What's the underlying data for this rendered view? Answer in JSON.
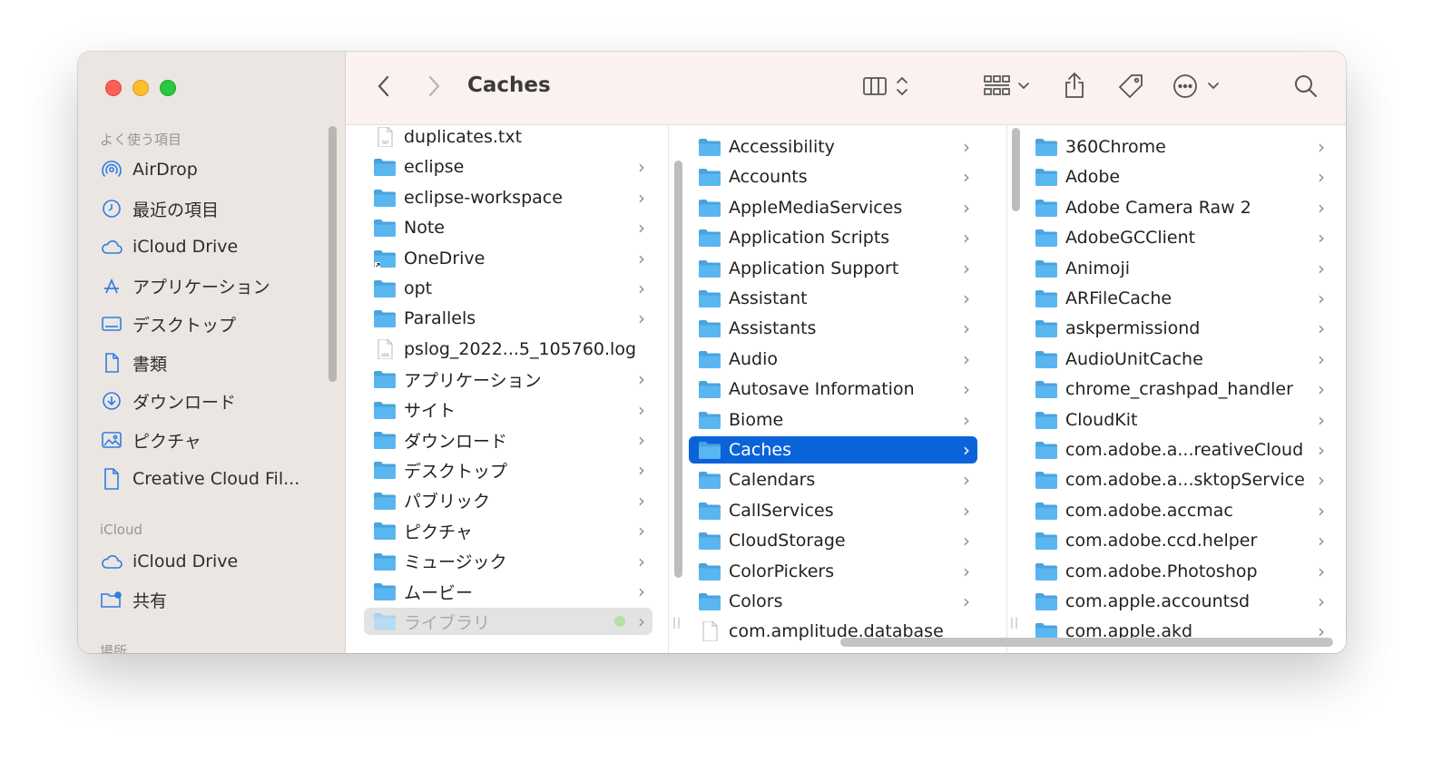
{
  "window": {
    "title": "Caches"
  },
  "sidebar": {
    "favorites_header": "よく使う項目",
    "favorites": [
      {
        "label": "AirDrop",
        "icon": "airdrop-icon"
      },
      {
        "label": "最近の項目",
        "icon": "clock-icon"
      },
      {
        "label": "iCloud Drive",
        "icon": "cloud-icon"
      },
      {
        "label": "アプリケーション",
        "icon": "applications-icon"
      },
      {
        "label": "デスクトップ",
        "icon": "desktop-icon"
      },
      {
        "label": "書類",
        "icon": "document-icon"
      },
      {
        "label": "ダウンロード",
        "icon": "download-icon"
      },
      {
        "label": "ピクチャ",
        "icon": "pictures-icon"
      },
      {
        "label": "Creative Cloud Fil...",
        "icon": "file-icon"
      }
    ],
    "icloud_header": "iCloud",
    "icloud": [
      {
        "label": "iCloud Drive",
        "icon": "cloud-icon"
      },
      {
        "label": "共有",
        "icon": "shared-folder-icon"
      }
    ],
    "locations_header": "場所"
  },
  "toolbar": {
    "back": "back-icon",
    "forward": "forward-icon",
    "view": "column-view-icon",
    "group": "group-icon",
    "share": "share-icon",
    "tag": "tag-icon",
    "more": "more-icon",
    "search": "search-icon"
  },
  "columns": {
    "col1": [
      {
        "name": "duplicates.txt",
        "kind": "file"
      },
      {
        "name": "eclipse",
        "kind": "folder"
      },
      {
        "name": "eclipse-workspace",
        "kind": "folder"
      },
      {
        "name": "Note",
        "kind": "folder"
      },
      {
        "name": "OneDrive",
        "kind": "alias"
      },
      {
        "name": "opt",
        "kind": "folder"
      },
      {
        "name": "Parallels",
        "kind": "folder"
      },
      {
        "name": "pslog_2022...5_105760.log",
        "kind": "log"
      },
      {
        "name": "アプリケーション",
        "kind": "folder"
      },
      {
        "name": "サイト",
        "kind": "folder"
      },
      {
        "name": "ダウンロード",
        "kind": "folder"
      },
      {
        "name": "デスクトップ",
        "kind": "folder"
      },
      {
        "name": "パブリック",
        "kind": "folder"
      },
      {
        "name": "ピクチャ",
        "kind": "folder"
      },
      {
        "name": "ミュージック",
        "kind": "folder"
      },
      {
        "name": "ムービー",
        "kind": "folder"
      },
      {
        "name": "ライブラリ",
        "kind": "folder"
      }
    ],
    "col2": [
      "Accessibility",
      "Accounts",
      "AppleMediaServices",
      "Application Scripts",
      "Application Support",
      "Assistant",
      "Assistants",
      "Audio",
      "Autosave Information",
      "Biome",
      "Caches",
      "Calendars",
      "CallServices",
      "CloudStorage",
      "ColorPickers",
      "Colors",
      "com.amplitude.database"
    ],
    "col3": [
      "360Chrome",
      "Adobe",
      "Adobe Camera Raw 2",
      "AdobeGCClient",
      "Animoji",
      "ARFileCache",
      "askpermissiond",
      "AudioUnitCache",
      "chrome_crashpad_handler",
      "CloudKit",
      "com.adobe.a...reativeCloud",
      "com.adobe.a...sktopService",
      "com.adobe.accmac",
      "com.adobe.ccd.helper",
      "com.adobe.Photoshop",
      "com.apple.accountsd",
      "com.apple.akd"
    ]
  },
  "colors": {
    "accent": "#0b63d9",
    "folder": "#5ab6f0"
  }
}
